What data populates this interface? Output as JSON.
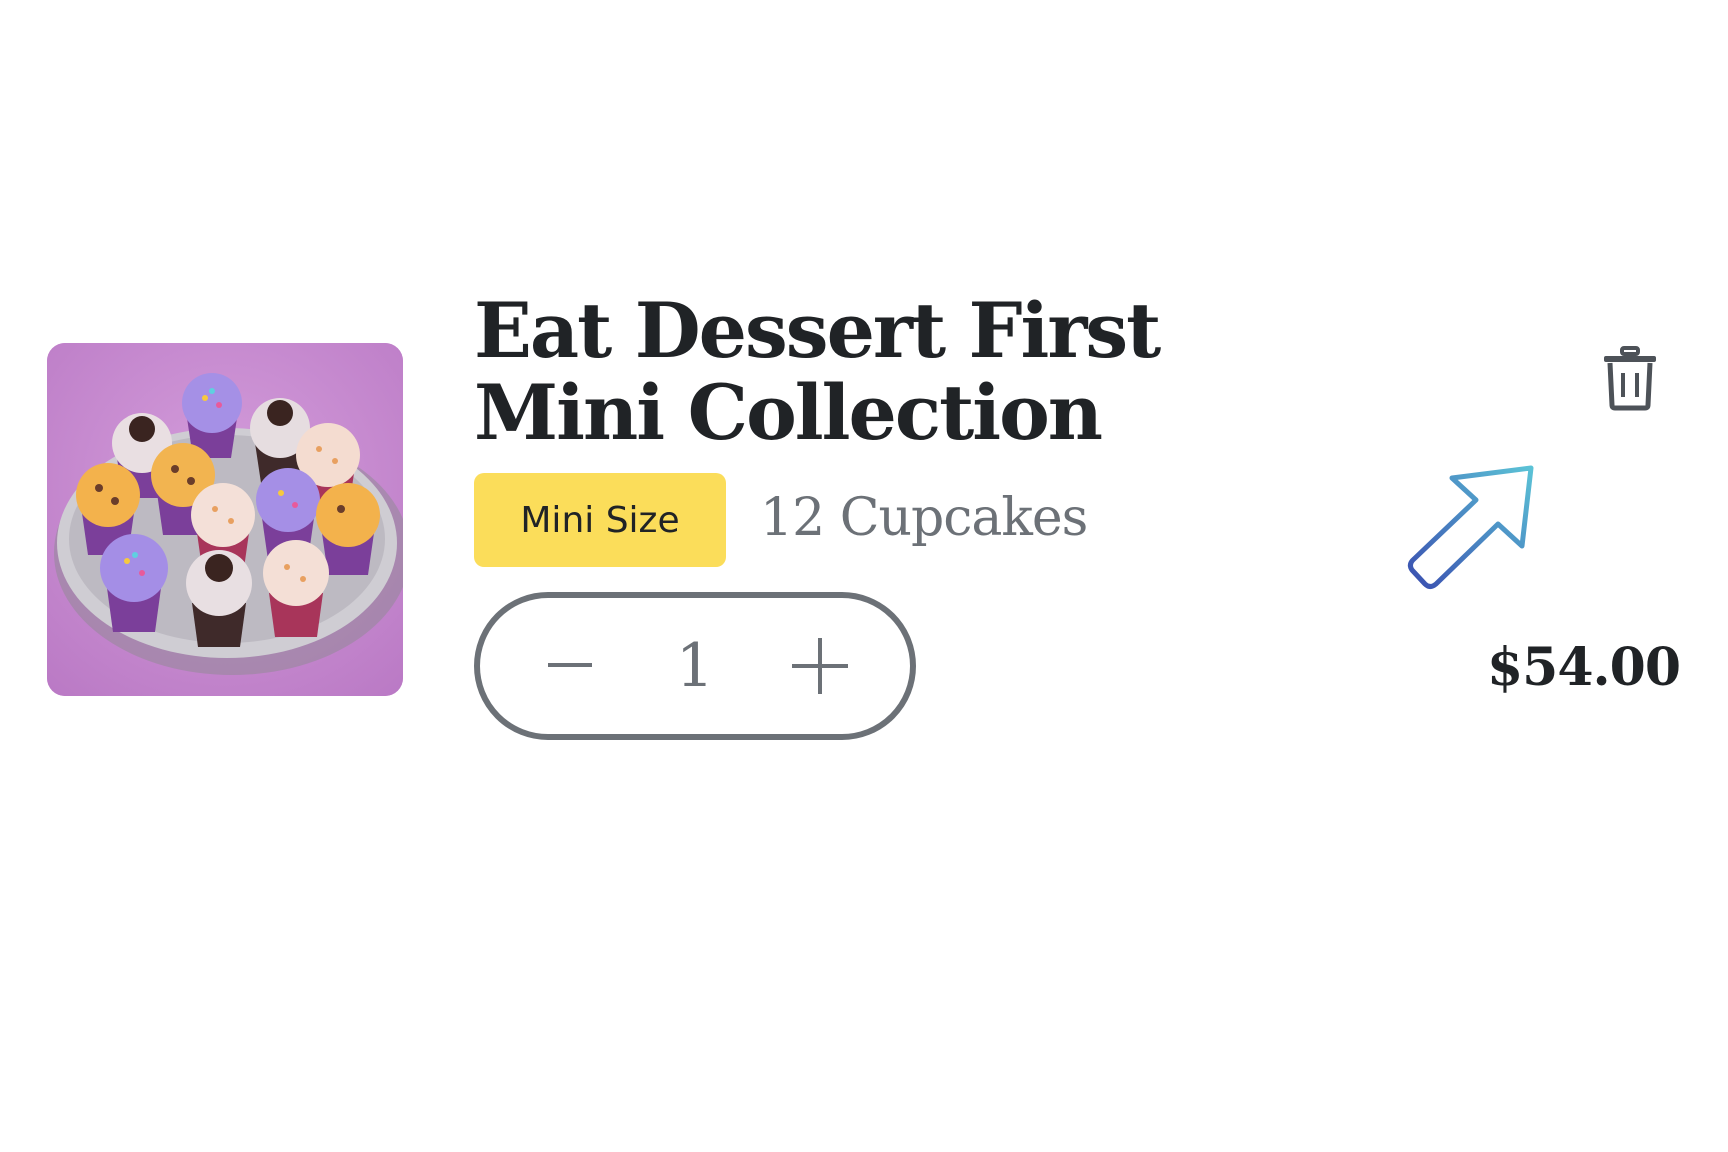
{
  "cart_item": {
    "title": "Eat Dessert First Mini Collection",
    "size_badge": "Mini Size",
    "count_text": "12 Cupcakes",
    "quantity": "1",
    "price": "$54.00",
    "image_alt": "cupcakes-platter-image"
  },
  "icons": {
    "decrease": "minus-icon",
    "increase": "plus-icon",
    "remove": "trash-icon",
    "pointer": "cursor-arrow-icon"
  },
  "colors": {
    "badge_background": "#fbdd5a",
    "image_background": "#c98ad2",
    "text_dark": "#202326",
    "text_muted": "#6c7177",
    "cursor_gradient_start": "#5bc2d6",
    "cursor_gradient_end": "#3a4fb0"
  }
}
